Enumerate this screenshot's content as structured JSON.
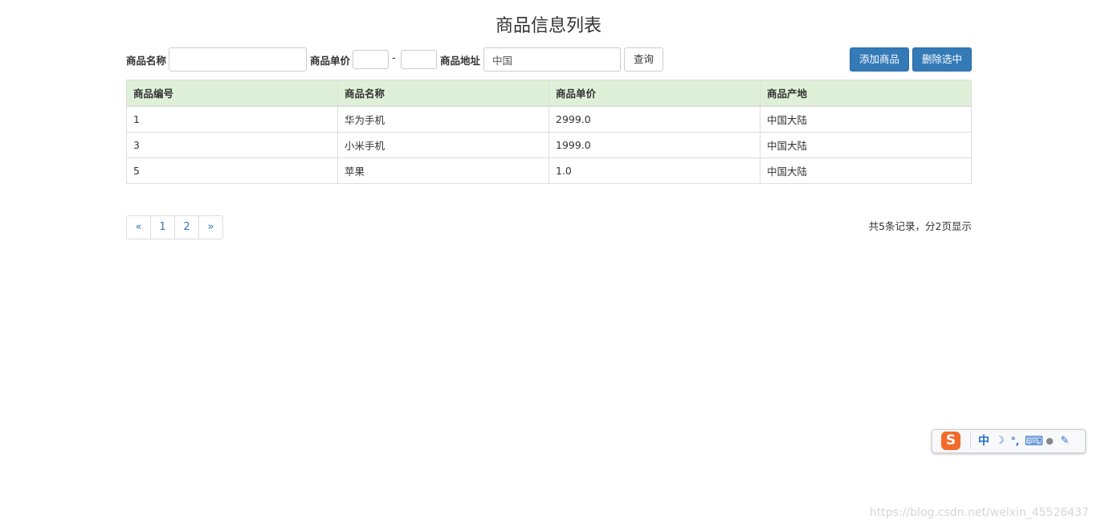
{
  "page": {
    "title": "商品信息列表"
  },
  "search": {
    "name_label": "商品名称",
    "name_value": "",
    "price_label": "商品单价",
    "price_min_value": "",
    "price_max_value": "",
    "price_separator": "-",
    "address_label": "商品地址",
    "address_value": "中国",
    "query_button": "查询"
  },
  "actions": {
    "add_button": "添加商品",
    "delete_button": "删除选中"
  },
  "table": {
    "headers": [
      "商品编号",
      "商品名称",
      "商品单价",
      "商品产地"
    ],
    "rows": [
      [
        "1",
        "华为手机",
        "2999.0",
        "中国大陆"
      ],
      [
        "3",
        "小米手机",
        "1999.0",
        "中国大陆"
      ],
      [
        "5",
        "苹果",
        "1.0",
        "中国大陆"
      ]
    ]
  },
  "pagination": {
    "prev": "«",
    "pages": [
      "1",
      "2"
    ],
    "next": "»",
    "summary": "共5条记录，分2页显示"
  },
  "ime": {
    "logo": "S",
    "mode": "中",
    "moon": "☽",
    "punct": "°,",
    "keyboard": "⌨",
    "user": "●",
    "tool": "✎",
    "icons": [
      "sogou-logo-icon",
      "moon-icon",
      "punctuation-icon",
      "keyboard-icon",
      "user-icon",
      "wrench-icon"
    ]
  },
  "watermark": "https://blog.csdn.net/weixin_45526437",
  "colors": {
    "primary": "#337ab7",
    "header_bg": "#dff0d8",
    "border": "#dddddd",
    "ime_orange": "#f26b2a"
  }
}
